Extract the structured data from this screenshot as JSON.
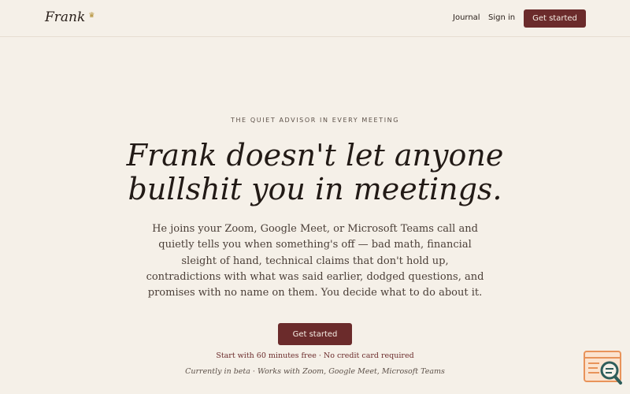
{
  "nav": {
    "brand": "Frank",
    "brand_icon": "crown-icon",
    "links": [
      "Journal",
      "Sign in"
    ],
    "cta_label": "Get started"
  },
  "hero": {
    "eyebrow": "THE QUIET ADVISOR IN EVERY MEETING",
    "headline": "Frank doesn't let anyone bullshit you in meetings.",
    "lede": "He joins your Zoom, Google Meet, or Microsoft Teams call and quietly tells you when something's off — bad math, financial sleight of hand, technical claims that don't hold up, contradictions with what was said earlier, dodged questions, and promises with no name on them. You decide what to do about it.",
    "cta_label": "Get started",
    "subnote": "Start with 60 minutes free · No credit card required",
    "betanote": "Currently in beta · Works with Zoom, Google Meet, Microsoft Teams"
  },
  "widget": {
    "icon": "search-document-icon"
  },
  "colors": {
    "background": "#f5f0e8",
    "accent": "#6b2b2b",
    "text": "#2a201b",
    "widget_orange": "#e8935a",
    "widget_teal": "#2e5d5a"
  }
}
